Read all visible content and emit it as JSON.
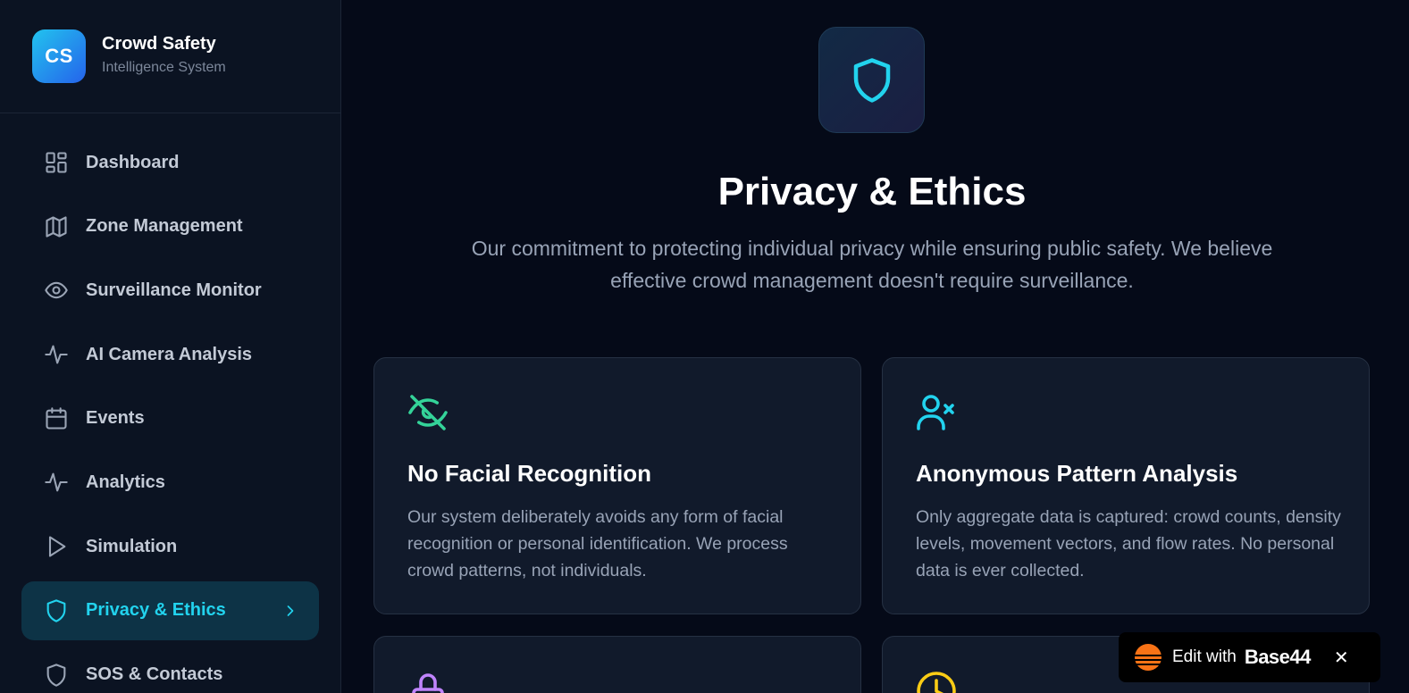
{
  "brand": {
    "logo_text": "CS",
    "title": "Crowd Safety",
    "subtitle": "Intelligence System"
  },
  "sidebar": {
    "items": [
      {
        "label": "Dashboard",
        "icon": "grid-icon"
      },
      {
        "label": "Zone Management",
        "icon": "map-icon"
      },
      {
        "label": "Surveillance Monitor",
        "icon": "eye-icon"
      },
      {
        "label": "AI Camera Analysis",
        "icon": "activity-icon"
      },
      {
        "label": "Events",
        "icon": "calendar-icon"
      },
      {
        "label": "Analytics",
        "icon": "activity-icon"
      },
      {
        "label": "Simulation",
        "icon": "play-icon"
      },
      {
        "label": "Privacy & Ethics",
        "icon": "shield-icon",
        "active": true
      },
      {
        "label": "SOS & Contacts",
        "icon": "shield-icon"
      }
    ]
  },
  "page": {
    "title": "Privacy & Ethics",
    "subtitle": "Our commitment to protecting individual privacy while ensuring public safety. We believe effective crowd management doesn't require surveillance."
  },
  "cards": [
    {
      "icon": "eye-off-icon",
      "title": "No Facial Recognition",
      "body": "Our system deliberately avoids any form of facial recognition or personal identification. We process crowd patterns, not individuals."
    },
    {
      "icon": "user-x-icon",
      "title": "Anonymous Pattern Analysis",
      "body": "Only aggregate data is captured: crowd counts, density levels, movement vectors, and flow rates. No personal data is ever collected."
    },
    {
      "icon": "lock-icon"
    },
    {
      "icon": "clock-icon"
    }
  ],
  "badge": {
    "text": "Edit with",
    "brand": "Base44",
    "close": "✕"
  },
  "colors": {
    "accent": "#22d3ee",
    "green": "#34d399",
    "purple": "#c084fc",
    "yellow": "#facc15",
    "background": "#050a18",
    "sidebar": "#0b1322"
  }
}
